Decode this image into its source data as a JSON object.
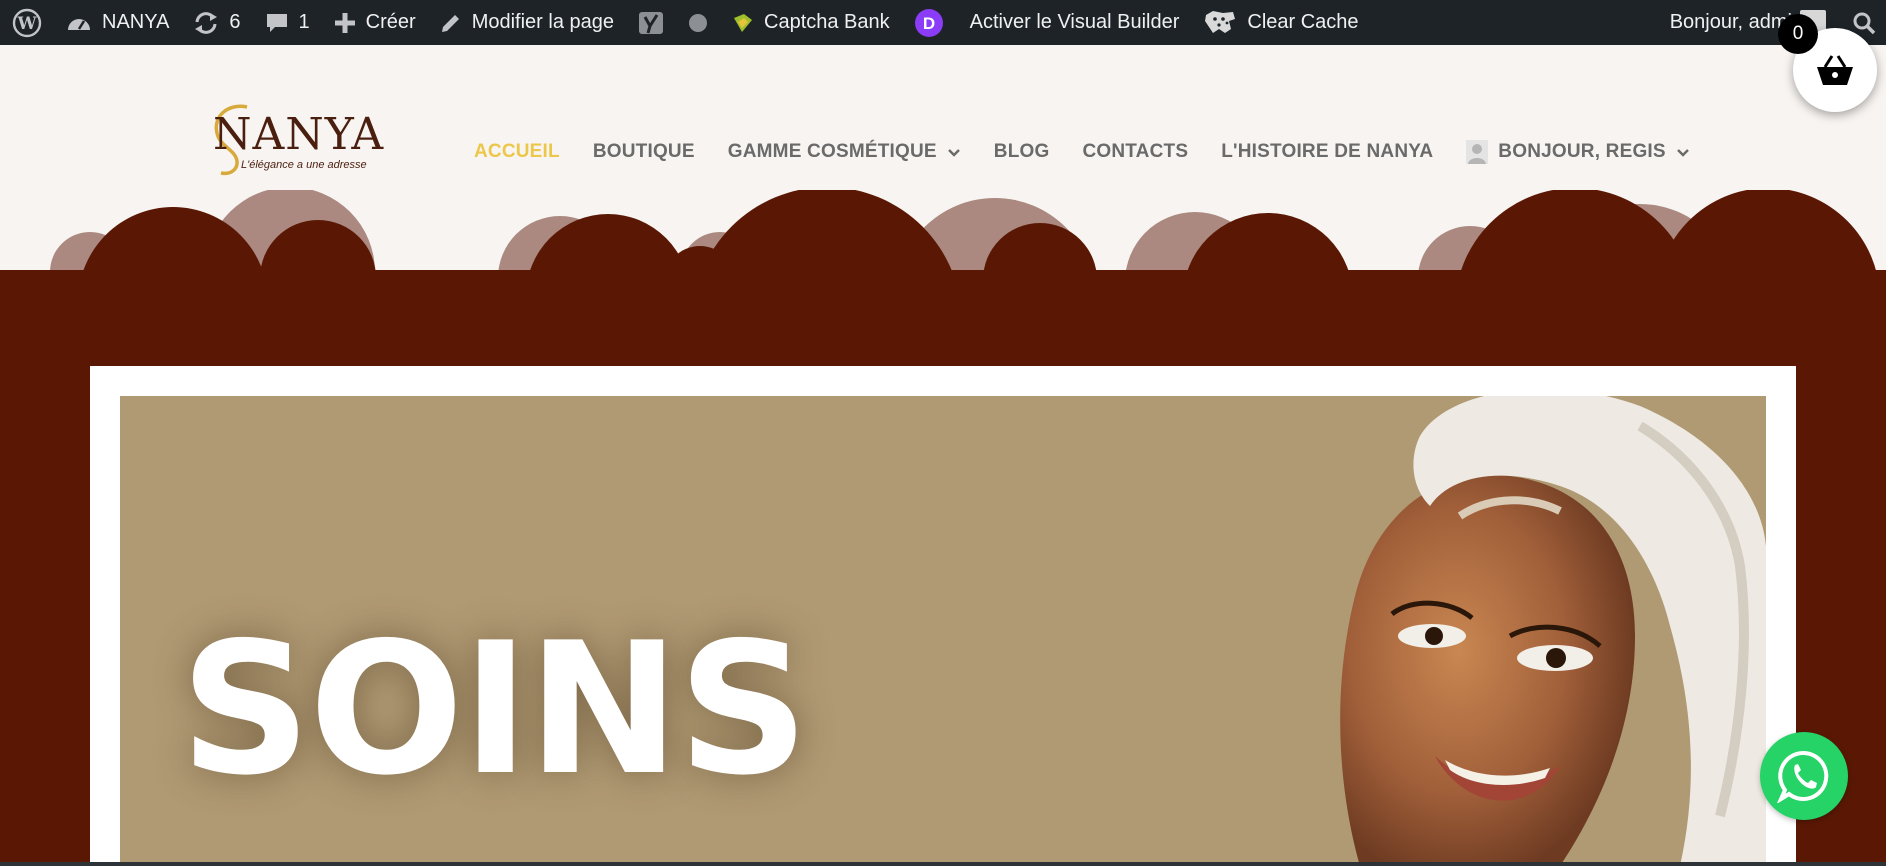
{
  "admin_bar": {
    "site_name": "NANYA",
    "updates_count": "6",
    "comments_count": "1",
    "create_label": "Créer",
    "edit_page_label": "Modifier la page",
    "captcha_label": "Captcha Bank",
    "visual_builder_label": "Activer le Visual Builder",
    "clear_cache_label": "Clear Cache",
    "greeting": "Bonjour, admi"
  },
  "logo": {
    "brand": "NANYA",
    "tagline": "L'élégance a une adresse"
  },
  "nav": {
    "items": [
      {
        "label": "ACCUEIL"
      },
      {
        "label": "BOUTIQUE"
      },
      {
        "label": "GAMME COSMÉTIQUE"
      },
      {
        "label": "BLOG"
      },
      {
        "label": "CONTACTS"
      },
      {
        "label": "L'HISTOIRE DE NANYA"
      },
      {
        "label": "BONJOUR, REGIS"
      }
    ]
  },
  "cart": {
    "count": "0"
  },
  "hero": {
    "title": "SOINS"
  },
  "colors": {
    "admin_bg": "#1d2327",
    "header_bg": "#f8f4f1",
    "brand_dark": "#5a1804",
    "cloud_light": "#ab8980",
    "nav_active": "#ecc84a",
    "hero_bg": "#b09a73",
    "whatsapp": "#25d366"
  }
}
